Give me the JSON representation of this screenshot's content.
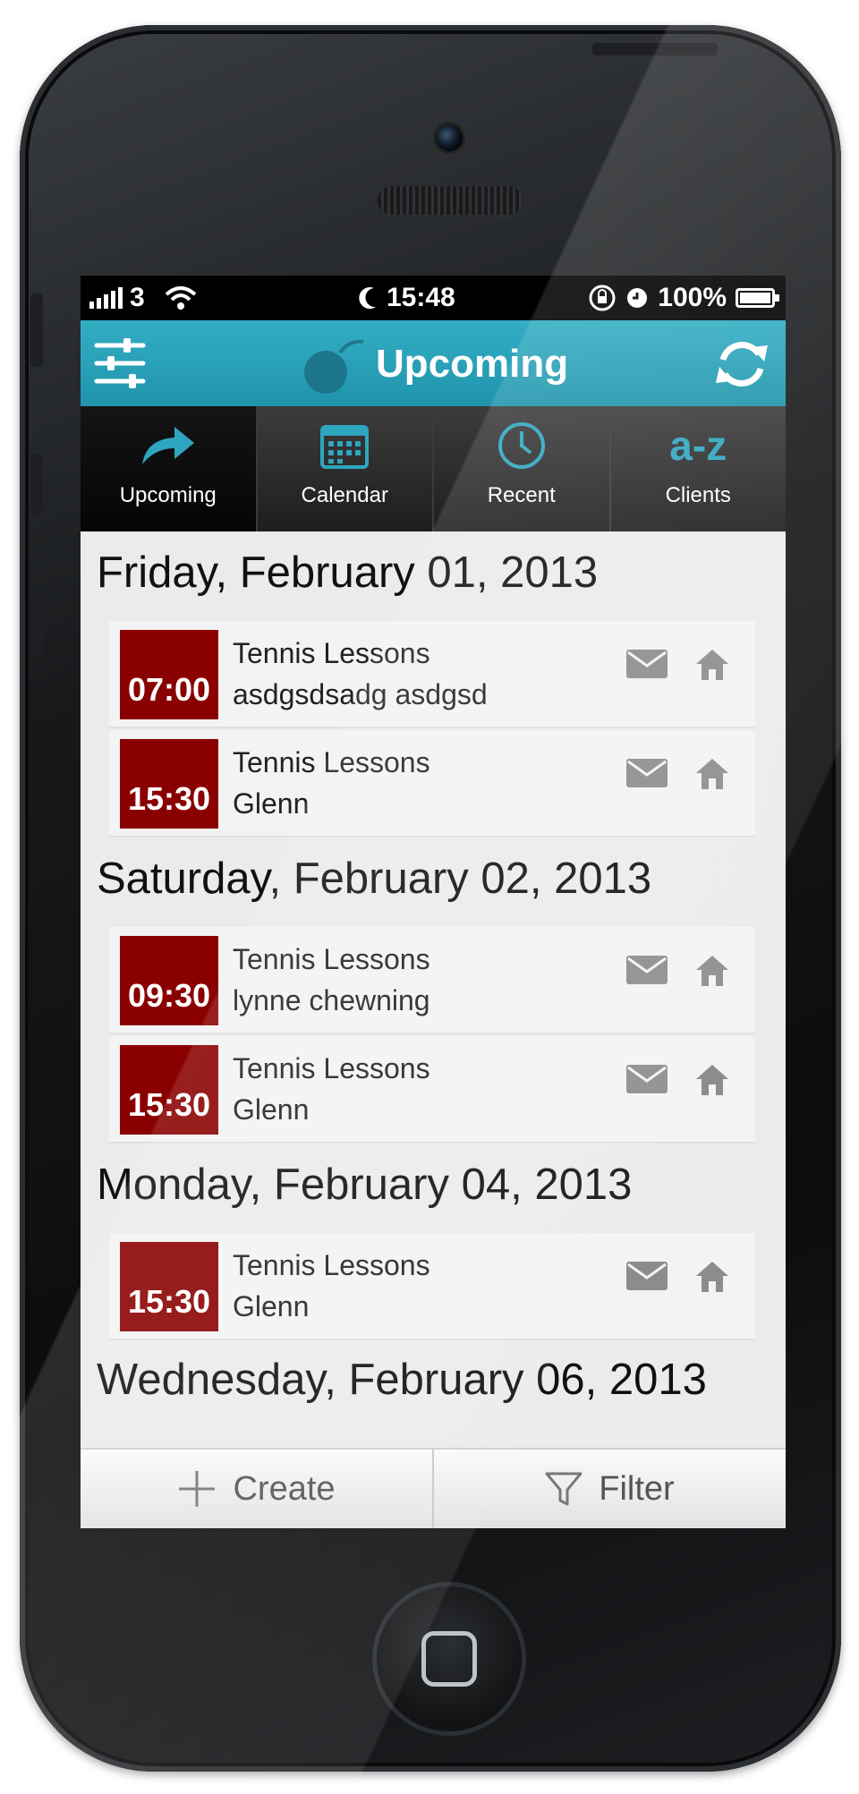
{
  "status_bar": {
    "carrier": "3",
    "time": "15:48",
    "battery": "100%"
  },
  "header": {
    "title": "Upcoming"
  },
  "tabs": [
    {
      "label": "Upcoming",
      "icon": "arrow-forward-icon",
      "active": true
    },
    {
      "label": "Calendar",
      "icon": "calendar-icon",
      "active": false
    },
    {
      "label": "Recent",
      "icon": "clock-icon",
      "active": false
    },
    {
      "label": "Clients",
      "icon_text": "a-z",
      "active": false
    }
  ],
  "days": [
    {
      "date": "Friday, February 01, 2013",
      "appointments": [
        {
          "time": "07:00",
          "title": "Tennis Lessons",
          "client": "asdgsdsadg asdgsd"
        },
        {
          "time": "15:30",
          "title": "Tennis Lessons",
          "client": "Glenn"
        }
      ]
    },
    {
      "date": "Saturday, February 02, 2013",
      "appointments": [
        {
          "time": "09:30",
          "title": "Tennis Lessons",
          "client": "lynne chewning"
        },
        {
          "time": "15:30",
          "title": "Tennis Lessons",
          "client": "Glenn"
        }
      ]
    },
    {
      "date": "Monday, February 04, 2013",
      "appointments": [
        {
          "time": "15:30",
          "title": "Tennis Lessons",
          "client": "Glenn"
        }
      ]
    },
    {
      "date": "Wednesday, February 06, 2013",
      "appointments": []
    }
  ],
  "bottom_bar": {
    "create_label": "Create",
    "filter_label": "Filter"
  },
  "colors": {
    "header": "#2aa3bb",
    "time_box": "#8a0000",
    "accent_icon": "#2ea6bf"
  }
}
